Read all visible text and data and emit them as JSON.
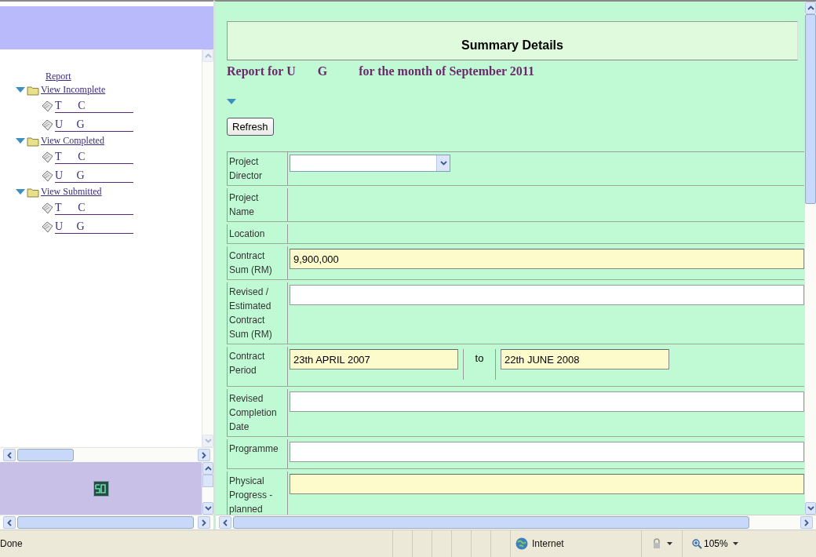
{
  "tree": [
    {
      "label": "Report",
      "kind": "link"
    },
    {
      "label": "View Incomplete",
      "kind": "folder",
      "expanded": true,
      "children": [
        {
          "label": "T      C"
        },
        {
          "label": "U     G"
        }
      ]
    },
    {
      "label": "View Completed",
      "kind": "folder",
      "expanded": true,
      "children": [
        {
          "label": "T      C"
        },
        {
          "label": "U     G"
        }
      ]
    },
    {
      "label": "View Submitted",
      "kind": "folder",
      "expanded": true,
      "children": [
        {
          "label": "T      C"
        },
        {
          "label": "U     G"
        }
      ]
    }
  ],
  "main": {
    "title": "Summary Details",
    "report_heading": "Report for U       G          for the month of September 2011",
    "section_expanded": true,
    "refresh_button": "Refresh"
  },
  "form": [
    {
      "label": "Project Director",
      "kind": "select"
    },
    {
      "label": "Project Name",
      "kind": "blank"
    },
    {
      "label": "Location",
      "kind": "blank"
    },
    {
      "label": "Contract Sum (RM)",
      "kind": "input",
      "highlighted": true,
      "value": "9,900,000"
    },
    {
      "label": "Revised / Estimated Contract Sum (RM)",
      "kind": "input",
      "highlighted": false
    },
    {
      "label": "Contract Period",
      "kind": "period",
      "from": "23th APRIL 2007",
      "separator": "to",
      "to": "22th JUNE 2008"
    },
    {
      "label": "Revised Completion Date",
      "kind": "input",
      "highlighted": false
    },
    {
      "label": "Programme",
      "kind": "input",
      "highlighted": false
    },
    {
      "label": "Physical Progress - planned",
      "kind": "input",
      "highlighted": true
    }
  ],
  "status_bar": {
    "text": "Done",
    "zone": "Internet",
    "zoom": "105%"
  }
}
